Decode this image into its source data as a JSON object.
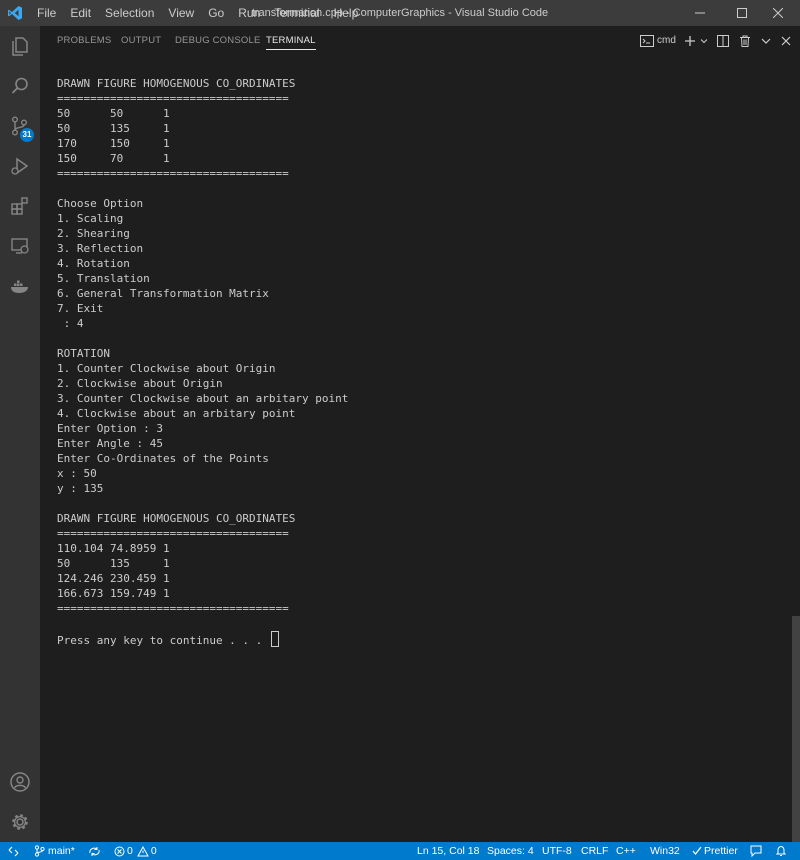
{
  "window": {
    "title": "transformation.cpp - ComputerGraphics - Visual Studio Code",
    "menu": [
      "File",
      "Edit",
      "Selection",
      "View",
      "Go",
      "Run",
      "Terminal",
      "Help"
    ]
  },
  "activity_bar": {
    "items": [
      {
        "icon": "explorer-icon"
      },
      {
        "icon": "search-icon"
      },
      {
        "icon": "source-control-icon",
        "badge": "31"
      },
      {
        "icon": "run-debug-icon"
      },
      {
        "icon": "extensions-icon"
      },
      {
        "icon": "remote-explorer-icon"
      },
      {
        "icon": "docker-icon"
      }
    ],
    "bottom": [
      {
        "icon": "account-icon"
      },
      {
        "icon": "settings-gear-icon"
      }
    ]
  },
  "panel": {
    "tabs": [
      "PROBLEMS",
      "OUTPUT",
      "DEBUG CONSOLE",
      "TERMINAL"
    ],
    "active_tab": "TERMINAL",
    "terminal_name": "cmd"
  },
  "terminal": {
    "lines": [
      "DRAWN FIGURE HOMOGENOUS CO_ORDINATES",
      "===================================",
      "50      50      1",
      "50      135     1",
      "170     150     1",
      "150     70      1",
      "===================================",
      "",
      "Choose Option",
      "1. Scaling",
      "2. Shearing",
      "3. Reflection",
      "4. Rotation",
      "5. Translation",
      "6. General Transformation Matrix",
      "7. Exit",
      " : 4",
      "",
      "ROTATION",
      "1. Counter Clockwise about Origin",
      "2. Clockwise about Origin",
      "3. Counter Clockwise about an arbitary point",
      "4. Clockwise about an arbitary point",
      "Enter Option : 3",
      "Enter Angle : 45",
      "Enter Co-Ordinates of the Points",
      "x : 50",
      "y : 135",
      "",
      "DRAWN FIGURE HOMOGENOUS CO_ORDINATES",
      "===================================",
      "110.104 74.8959 1",
      "50      135     1",
      "124.246 230.459 1",
      "166.673 159.749 1",
      "===================================",
      ""
    ],
    "prompt": "Press any key to continue . . . "
  },
  "status_bar": {
    "branch": "main*",
    "errors": "0",
    "warnings": "0",
    "position": "Ln 15, Col 18",
    "spaces": "Spaces: 4",
    "encoding": "UTF-8",
    "eol": "CRLF",
    "language": "C++",
    "platform": "Win32",
    "prettier": "Prettier"
  },
  "colors": {
    "accent": "#007acc",
    "titlebar": "#3c3c3c",
    "activitybar": "#333333",
    "editor_bg": "#1e1e1e"
  }
}
